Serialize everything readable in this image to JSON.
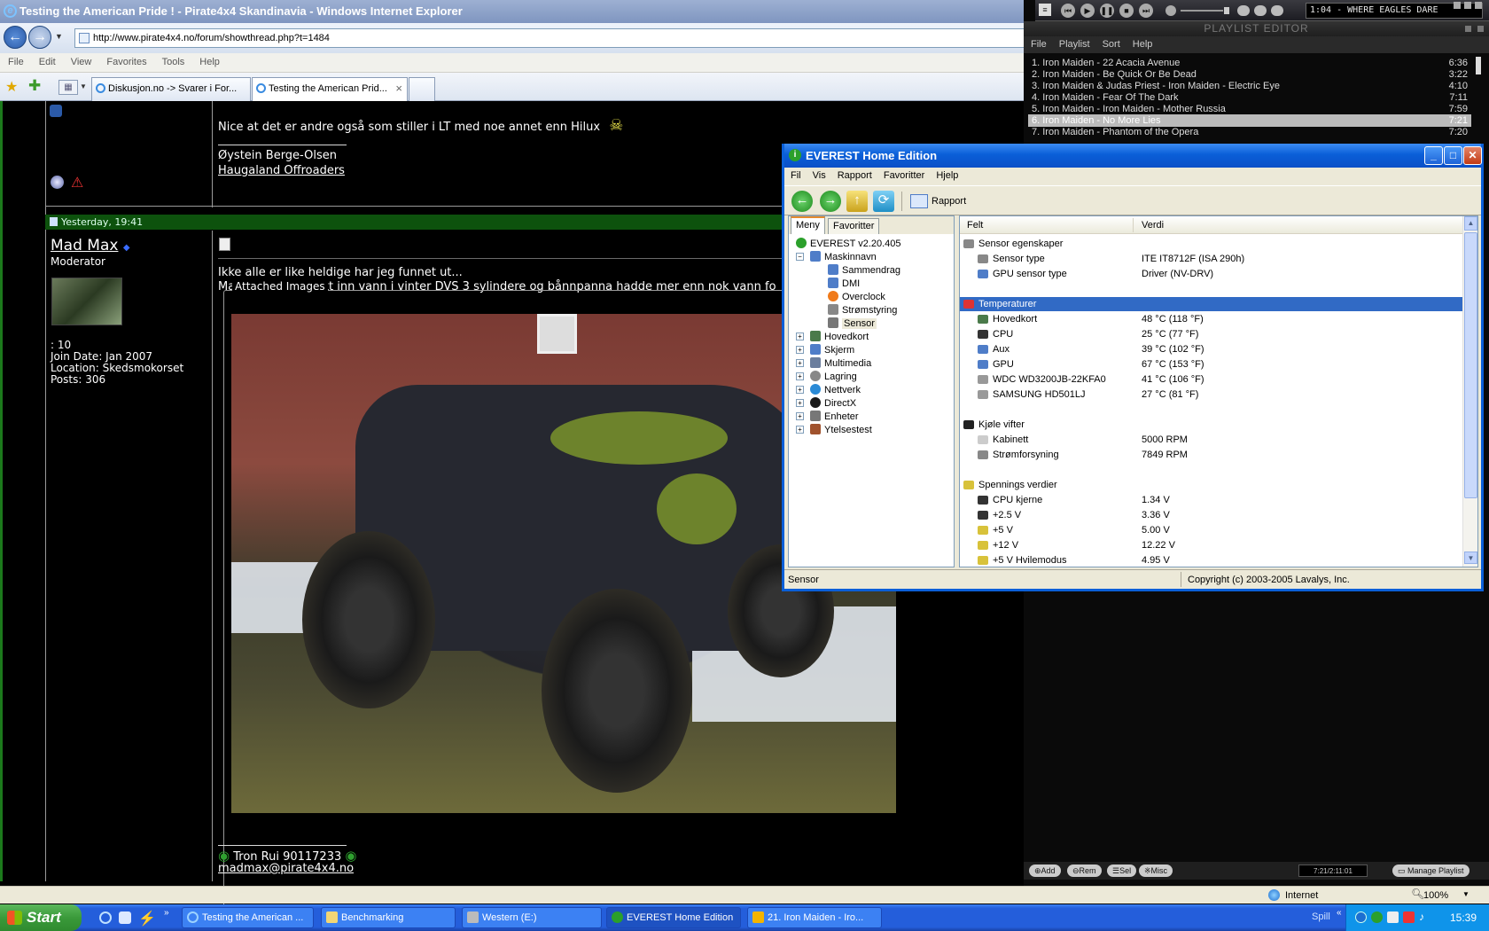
{
  "ie": {
    "title": "Testing the American Pride ! - Pirate4x4 Skandinavia - Windows Internet Explorer",
    "url": "http://www.pirate4x4.no/forum/showthread.php?t=1484",
    "menu": [
      "File",
      "Edit",
      "View",
      "Favorites",
      "Tools",
      "Help"
    ],
    "tabs": [
      {
        "label": "Diskusjon.no -> Svarer i For..."
      },
      {
        "label": "Testing the American Prid..."
      }
    ],
    "status": {
      "zone": "Internet",
      "zoom": "100%"
    }
  },
  "forum": {
    "post1": {
      "message": "Nice at det er andre også som stiller i LT med noe annet enn Hilux",
      "sig_name": "Øystein Berge-Olsen",
      "sig_club": "Haugaland Offroaders"
    },
    "post2": {
      "date": "Yesterday, 19:41",
      "username": "Mad Max",
      "role": "Moderator",
      "stat_blank": ": 10",
      "join_date": "Join Date: Jan 2007",
      "location": "Location: Skedsmokorset",
      "posts": "Posts: 306",
      "line1": "Ikke alle er like heldige har jeg funnet ut...",
      "line2": "Maskinisten har tatt inn vann i vinter DVS 3 sylindere og bånnpanna hadde mer enn nok vann fo",
      "attached_label": "Attached Images",
      "sig_phone": "Tron Rui 90117233",
      "sig_email": "madmax@pirate4x4.no"
    }
  },
  "winamp": {
    "display": "1:04  - WHERE EAGLES DARE",
    "playlist_title": "PLAYLIST EDITOR",
    "menu": [
      "File",
      "Playlist",
      "Sort",
      "Help"
    ],
    "tracks": [
      {
        "label": "1. Iron Maiden - 22 Acacia Avenue",
        "dur": "6:36"
      },
      {
        "label": "2. Iron Maiden - Be Quick Or Be Dead",
        "dur": "3:22"
      },
      {
        "label": "3. Iron Maiden & Judas Priest  - Iron Maiden - Electric Eye",
        "dur": "4:10"
      },
      {
        "label": "4. Iron Maiden - Fear Of The Dark",
        "dur": "7:11"
      },
      {
        "label": "5. Iron Maiden - Iron Maiden - Mother Russia",
        "dur": "7:59"
      },
      {
        "label": "6. Iron Maiden - No More Lies",
        "dur": "7:21"
      },
      {
        "label": "7. Iron Maiden - Phantom of the Opera",
        "dur": "7:20"
      }
    ],
    "selected_index": 5,
    "buttons": [
      "Add",
      "Rem",
      "Sel",
      "Misc"
    ],
    "time": "7:21/2:11:01",
    "manage": "Manage Playlist"
  },
  "everest": {
    "title": "EVEREST Home Edition",
    "menu": [
      "Fil",
      "Vis",
      "Rapport",
      "Favoritter",
      "Hjelp"
    ],
    "toolbar_report": "Rapport",
    "tabs": [
      "Meny",
      "Favoritter"
    ],
    "tree_root": "EVEREST v2.20.405",
    "tree_machine": "Maskinnavn",
    "tree_children": [
      "Sammendrag",
      "DMI",
      "Overclock",
      "Strømstyring",
      "Sensor"
    ],
    "tree_groups": [
      "Hovedkort",
      "Skjerm",
      "Multimedia",
      "Lagring",
      "Nettverk",
      "DirectX",
      "Enheter",
      "Ytelsestest"
    ],
    "col_field": "Felt",
    "col_value": "Verdi",
    "sections": {
      "sensor": "Sensor egenskaper",
      "temps": "Temperaturer",
      "fans": "Kjøle vifter",
      "volts": "Spennings verdier"
    },
    "sensor_rows": [
      {
        "f": "Sensor type",
        "v": "ITE IT8712F  (ISA 290h)"
      },
      {
        "f": "GPU sensor type",
        "v": "Driver  (NV-DRV)"
      }
    ],
    "temp_rows": [
      {
        "f": "Hovedkort",
        "v": "48 °C  (118 °F)"
      },
      {
        "f": "CPU",
        "v": "25 °C  (77 °F)"
      },
      {
        "f": "Aux",
        "v": "39 °C  (102 °F)"
      },
      {
        "f": "GPU",
        "v": "67 °C  (153 °F)"
      },
      {
        "f": "WDC WD3200JB-22KFA0",
        "v": "41 °C  (106 °F)"
      },
      {
        "f": "SAMSUNG HD501LJ",
        "v": "27 °C  (81 °F)"
      }
    ],
    "fan_rows": [
      {
        "f": "Kabinett",
        "v": "5000 RPM"
      },
      {
        "f": "Strømforsyning",
        "v": "7849 RPM"
      }
    ],
    "volt_rows": [
      {
        "f": "CPU kjerne",
        "v": "1.34 V"
      },
      {
        "f": "+2.5 V",
        "v": "3.36 V"
      },
      {
        "f": "+5 V",
        "v": "5.00 V"
      },
      {
        "f": "+12 V",
        "v": "12.22 V"
      },
      {
        "f": "+5 V Hvilemodus",
        "v": "4.95 V"
      }
    ],
    "status_left": "Sensor",
    "status_right": "Copyright (c) 2003-2005 Lavalys, Inc."
  },
  "taskbar": {
    "start": "Start",
    "tasks": [
      {
        "label": "Testing the American ..."
      },
      {
        "label": "Benchmarking"
      },
      {
        "label": "Western (E:)"
      },
      {
        "label": "EVEREST Home Edition"
      },
      {
        "label": "21. Iron Maiden - Iro..."
      }
    ],
    "spill": "Spill",
    "clock": "15:39"
  }
}
